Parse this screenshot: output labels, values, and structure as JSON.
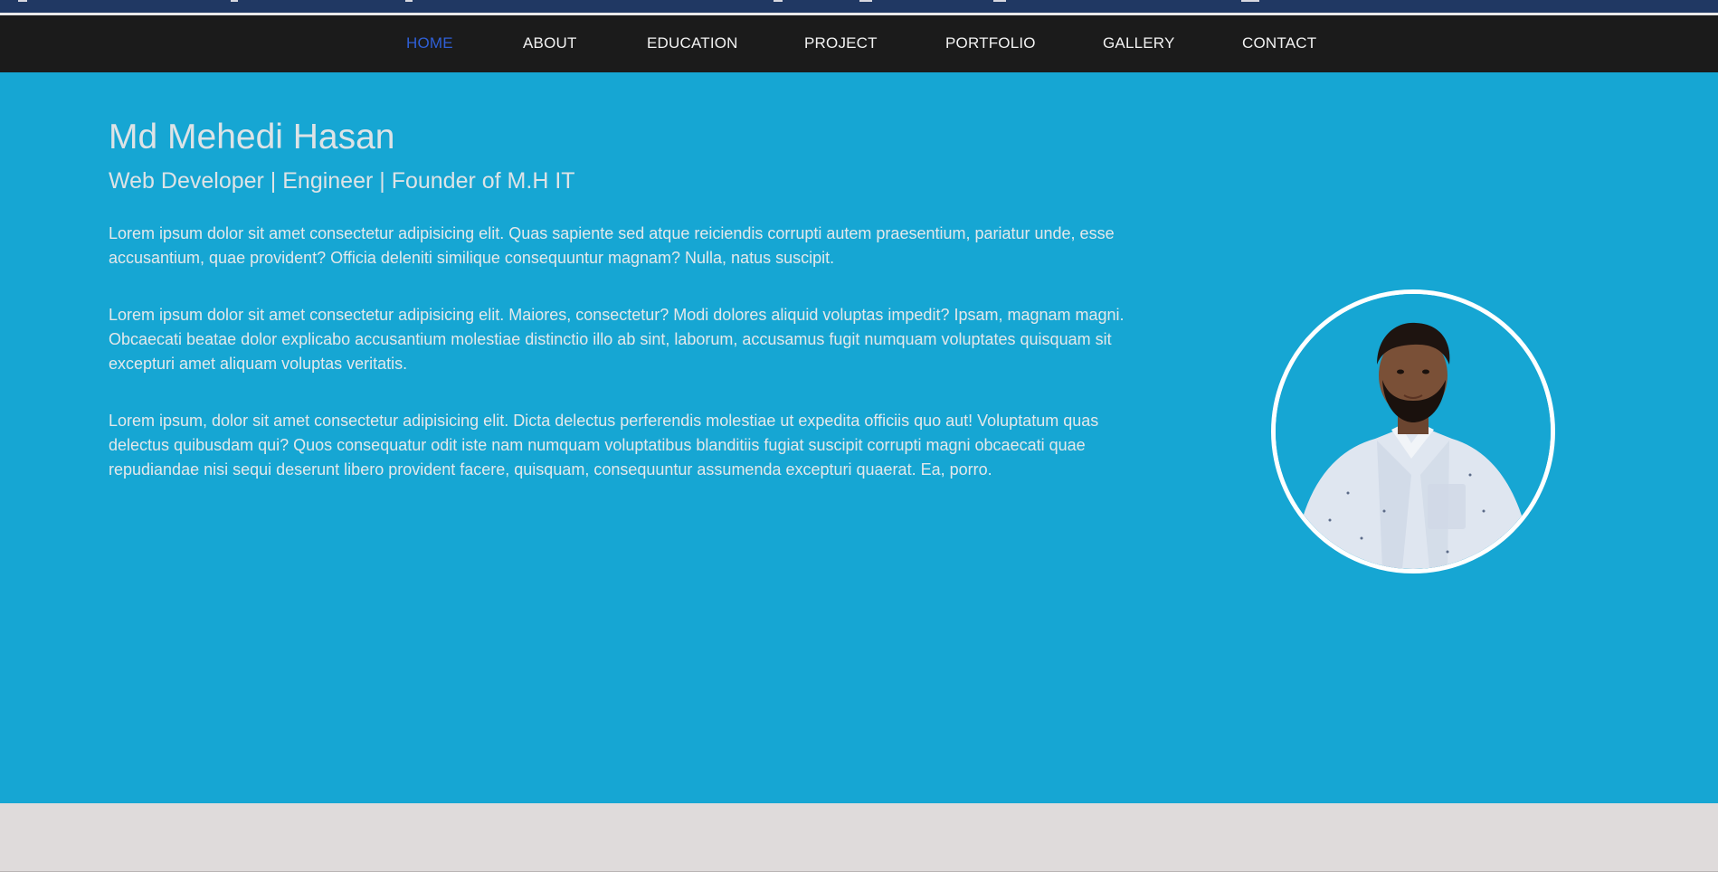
{
  "nav": {
    "home": "HOME",
    "about": "ABOUT",
    "education": "EDUCATION",
    "project": "PROJECT",
    "portfolio": "PORTFOLIO",
    "gallery": "GALLERY",
    "contact": "CONTACT"
  },
  "hero": {
    "name": "Md Mehedi Hasan",
    "tagline": "Web Developer | Engineer | Founder of M.H IT",
    "paragraphs": [
      "Lorem ipsum dolor sit amet consectetur adipisicing elit. Quas sapiente sed atque reiciendis corrupti autem praesentium, pariatur unde, esse accusantium, quae provident? Officia deleniti similique consequuntur magnam? Nulla, natus suscipit.",
      "Lorem ipsum dolor sit amet consectetur adipisicing elit. Maiores, consectetur? Modi dolores aliquid voluptas impedit? Ipsam, magnam magni. Obcaecati beatae dolor explicabo accusantium molestiae distinctio illo ab sint, laborum, accusamus fugit numquam voluptates quisquam sit excepturi amet aliquam voluptas veritatis.",
      "Lorem ipsum, dolor sit amet consectetur adipisicing elit. Dicta delectus perferendis molestiae ut expedita officiis quo aut! Voluptatum quas delectus quibusdam qui? Quos consequatur odit iste nam numquam voluptatibus blanditiis fugiat suscipit corrupti magni obcaecati quae repudiandae nisi sequi deserunt libero provident facere, quisquam, consequuntur assumenda excepturi quaerat. Ea, porro."
    ]
  },
  "colors": {
    "nav_bg": "#1b1b1b",
    "nav_active": "#2f5fd6",
    "hero_bg": "#16a6d3",
    "top_strip": "#203863",
    "page_bg": "#dfdbdb"
  },
  "icons": {
    "avatar": "profile-photo"
  }
}
